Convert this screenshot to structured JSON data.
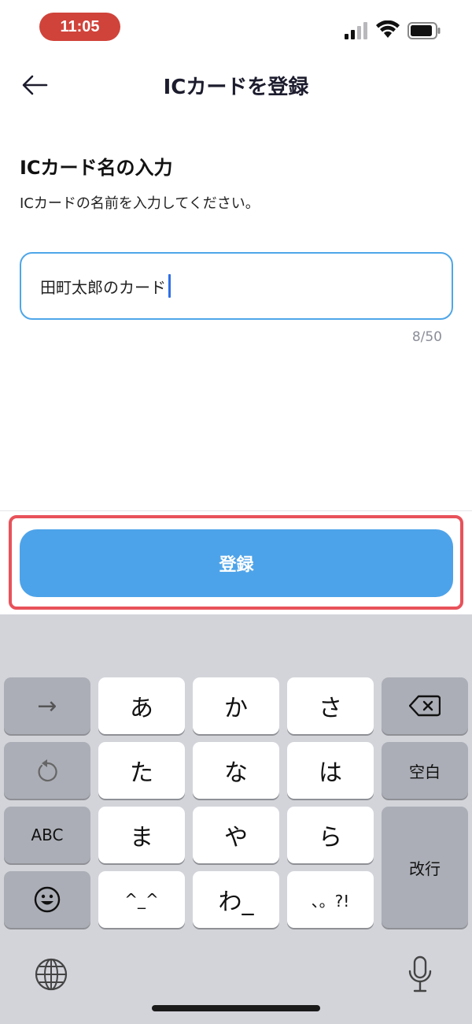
{
  "status_bar": {
    "time": "11:05"
  },
  "nav": {
    "title": "ICカードを登録",
    "back_icon": "arrow-left-icon"
  },
  "content": {
    "title": "ICカード名の入力",
    "description": "ICカードの名前を入力してください。",
    "input_value": "田町太郎のカード",
    "char_count": "8/50"
  },
  "button": {
    "register_label": "登録",
    "accent": "#4da3e9",
    "highlight": "#e8525a"
  },
  "keyboard": {
    "row1": {
      "left": "→",
      "keys": [
        "あ",
        "か",
        "さ"
      ],
      "right_icon": "delete-icon"
    },
    "row2": {
      "left_icon": "undo-icon",
      "keys": [
        "た",
        "な",
        "は"
      ],
      "right": "空白"
    },
    "row3": {
      "left": "ABC",
      "keys": [
        "ま",
        "や",
        "ら"
      ],
      "right": "改行"
    },
    "row4": {
      "left_icon": "emoji-icon",
      "keys": [
        "^_^",
        "わ_",
        "、。?!"
      ]
    },
    "bottom": {
      "globe_icon": "globe-icon",
      "mic_icon": "microphone-icon"
    }
  }
}
